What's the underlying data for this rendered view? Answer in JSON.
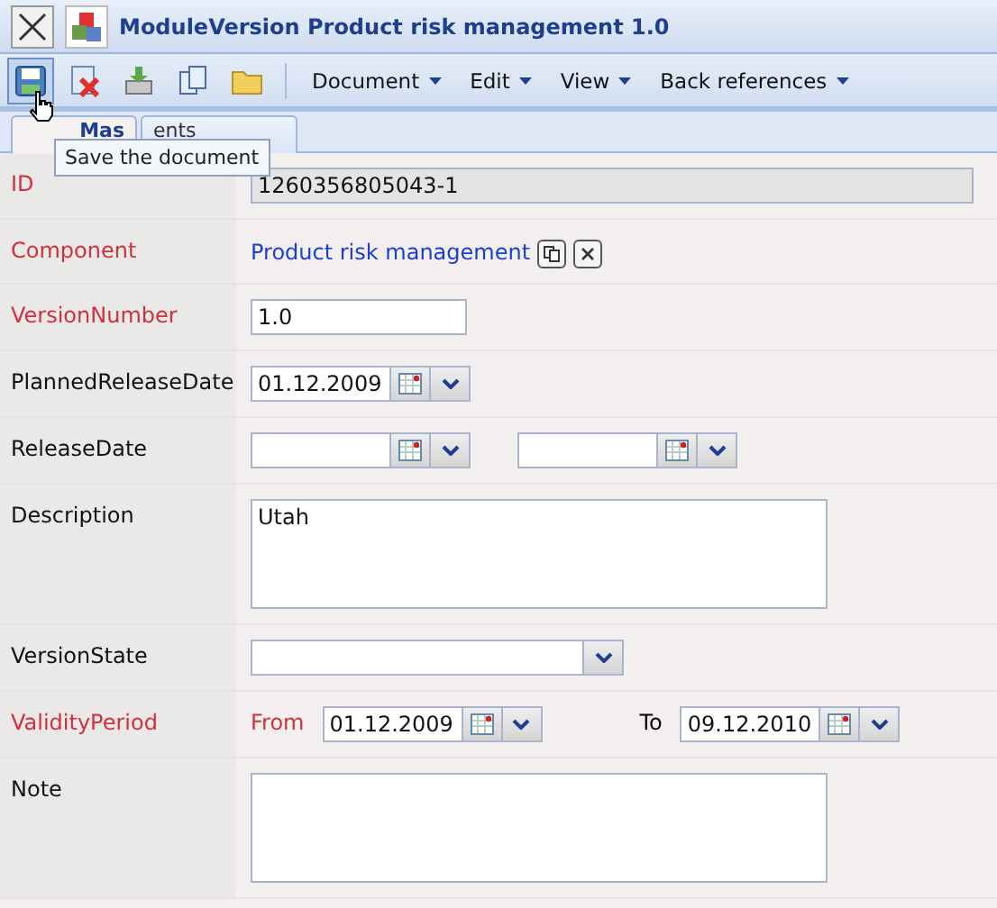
{
  "window": {
    "title": "ModuleVersion Product risk management 1.0"
  },
  "toolbar": {
    "menus": [
      {
        "label": "Document"
      },
      {
        "label": "Edit"
      },
      {
        "label": "View"
      },
      {
        "label": "Back references"
      }
    ],
    "tooltip": "Save the document"
  },
  "tabs": [
    {
      "label": "Mas",
      "selected": true
    },
    {
      "label": "ents",
      "selected": false
    }
  ],
  "fields": [
    {
      "kind": "readonly",
      "label": "ID",
      "required": true,
      "value": "1260356805043-1"
    },
    {
      "kind": "link",
      "label": "Component",
      "required": true,
      "value": "Product risk management"
    },
    {
      "kind": "text",
      "label": "VersionNumber",
      "required": true,
      "value": "1.0"
    },
    {
      "kind": "dates",
      "label": "PlannedReleaseDate",
      "required": false,
      "dates": [
        {
          "kind": "date",
          "value": "01.12.2009"
        }
      ]
    },
    {
      "kind": "dates",
      "label": "ReleaseDate",
      "required": false,
      "dates": [
        {
          "kind": "date"
        },
        {
          "kind": "date"
        }
      ]
    },
    {
      "kind": "textarea",
      "label": "Description",
      "required": false,
      "value": "Utah"
    },
    {
      "kind": "select",
      "label": "VersionState",
      "required": false
    },
    {
      "kind": "period",
      "label": "ValidityPeriod",
      "required": true,
      "parts": [
        {
          "label": "From",
          "required": true,
          "value": "01.12.2009"
        },
        {
          "label": "To",
          "required": false,
          "value": "09.12.2010"
        }
      ]
    },
    {
      "kind": "textarea",
      "label": "Note",
      "required": false
    }
  ]
}
